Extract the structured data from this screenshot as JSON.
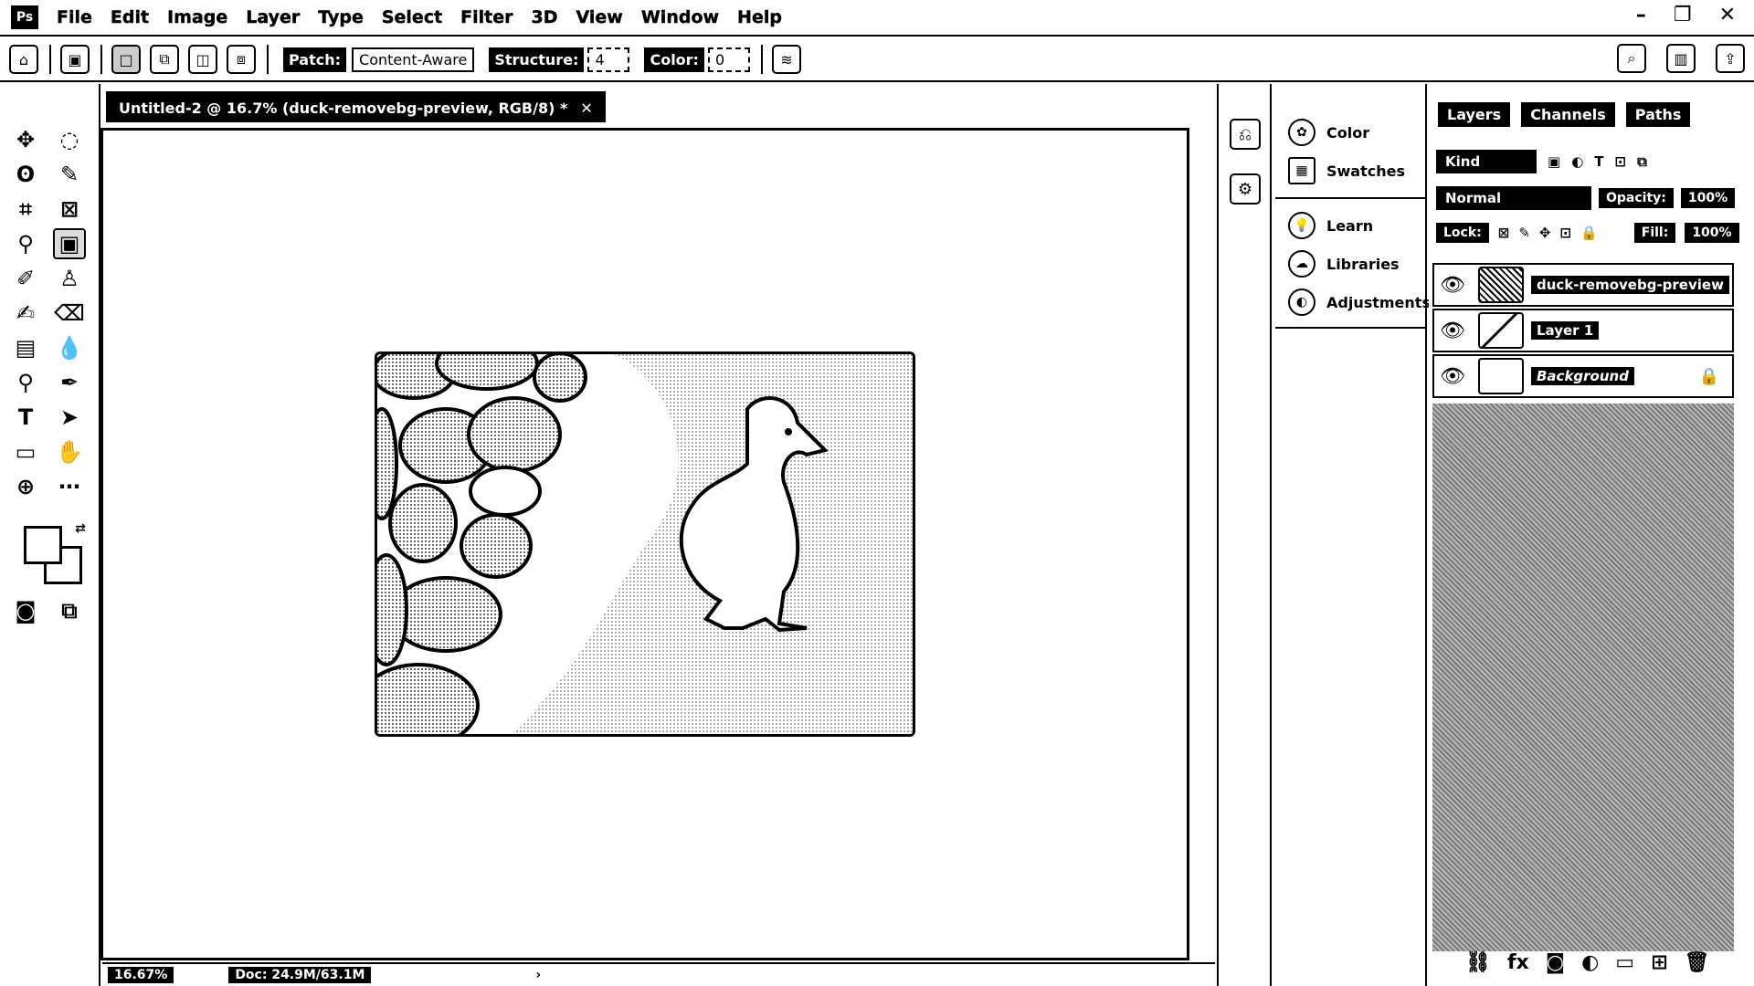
{
  "app": {
    "logo": "Ps"
  },
  "menu": [
    "File",
    "Edit",
    "Image",
    "Layer",
    "Type",
    "Select",
    "Filter",
    "3D",
    "View",
    "Window",
    "Help"
  ],
  "window_controls": {
    "minimize": "–",
    "restore": "❐",
    "close": "✕"
  },
  "options": {
    "patch_label": "Patch:",
    "patch_value": "Content-Aware",
    "structure_label": "Structure:",
    "structure_value": "4",
    "color_label": "Color:",
    "color_value": "0"
  },
  "document": {
    "tab_title": "Untitled-2 @ 16.7% (duck-removebg-preview, RGB/8) *",
    "tab_close": "✕"
  },
  "status": {
    "zoom": "16.67%",
    "doc": "Doc: 24.9M/63.1M"
  },
  "mid_panel": {
    "items": [
      "Color",
      "Swatches",
      "Learn",
      "Libraries",
      "Adjustments"
    ]
  },
  "layers_panel": {
    "tabs": [
      "Layers",
      "Channels",
      "Paths"
    ],
    "kind": "Kind",
    "blend_mode": "Normal",
    "opacity_label": "Opacity:",
    "opacity_value": "100%",
    "lock_label": "Lock:",
    "fill_label": "Fill:",
    "fill_value": "100%",
    "layers": [
      {
        "name": "duck-removebg-preview",
        "visible": true
      },
      {
        "name": "Layer 1",
        "visible": true
      },
      {
        "name": "Background",
        "visible": true,
        "locked": true
      }
    ]
  }
}
